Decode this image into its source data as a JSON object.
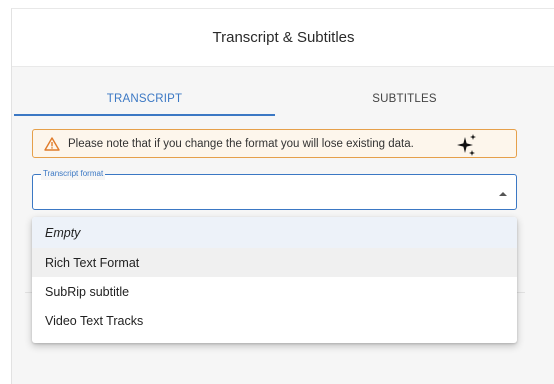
{
  "dialog": {
    "title": "Transcript & Subtitles"
  },
  "tabs": [
    {
      "label": "TRANSCRIPT",
      "active": true
    },
    {
      "label": "SUBTITLES",
      "active": false
    }
  ],
  "warning": {
    "text": "Please note that if you change the format you will lose existing data.",
    "icon": "warning-triangle-icon",
    "color": "#e6a04a"
  },
  "transcript_format": {
    "label": "Transcript format",
    "value": "",
    "options": [
      "Empty",
      "Rich Text Format",
      "SubRip subtitle",
      "Video Text Tracks"
    ]
  },
  "colors": {
    "accent": "#3b78c4",
    "warning": "#e6a04a"
  }
}
